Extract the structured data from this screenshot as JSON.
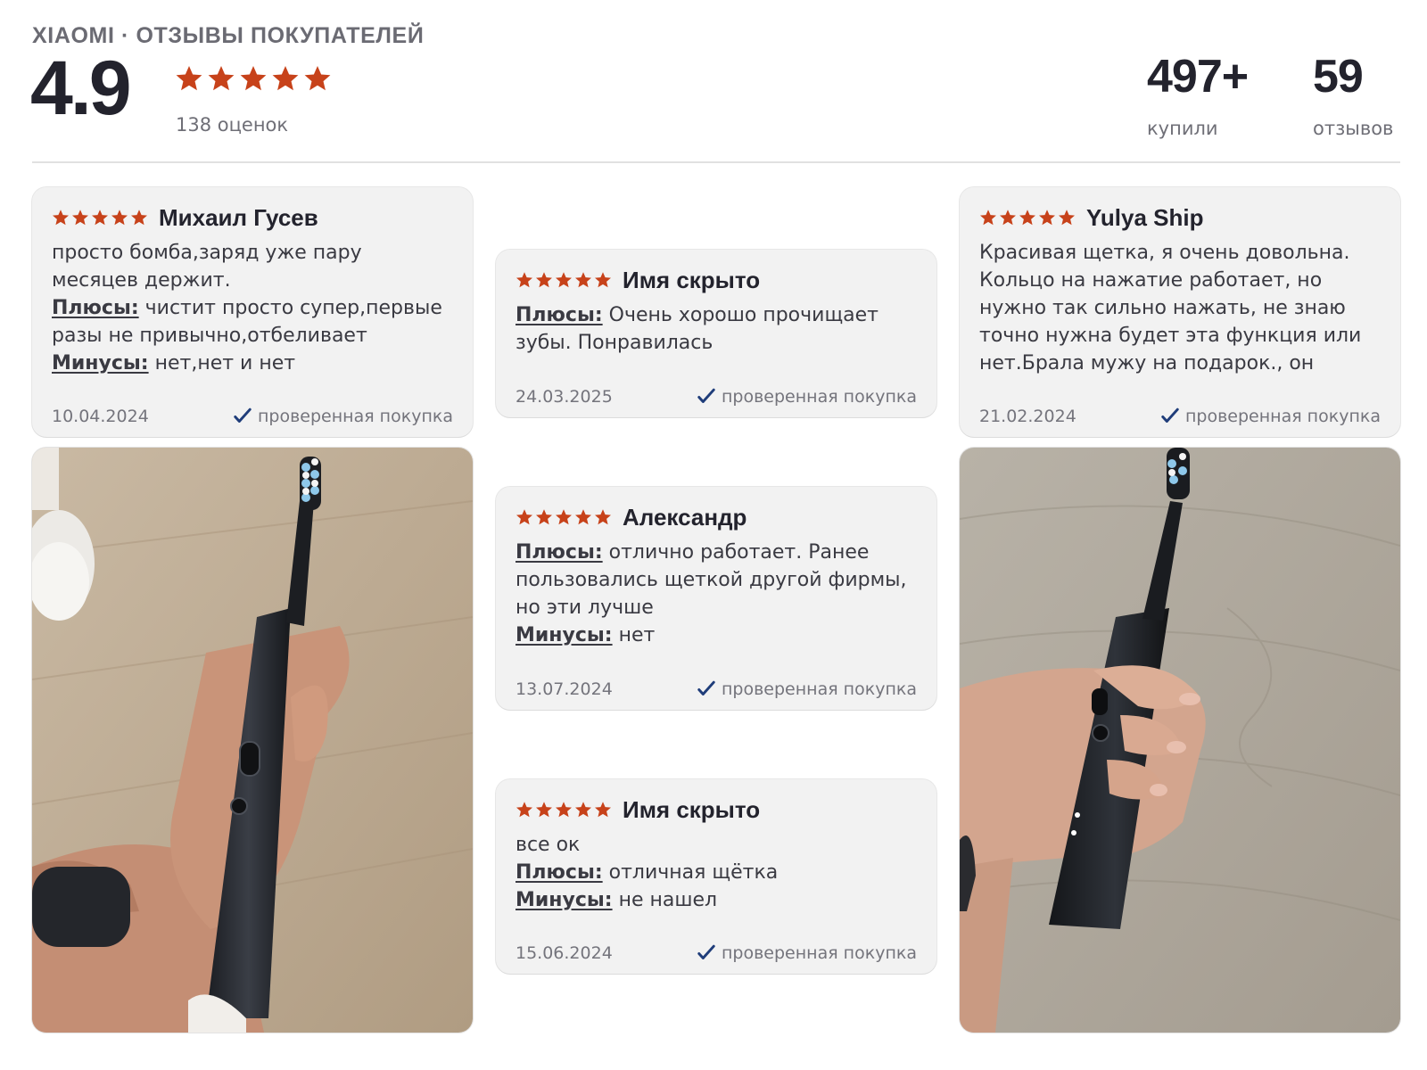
{
  "header": {
    "brand": "XIAOMI · ОТЗЫВЫ ПОКУПАТЕЛЕЙ",
    "rating": "4.9",
    "ratings_count": "138 оценок",
    "stats": [
      {
        "value": "497+",
        "label": "купили"
      },
      {
        "value": "59",
        "label": "отзывов"
      }
    ]
  },
  "colors": {
    "star": "#c7421a",
    "check": "#1f3d7a",
    "card_bg": "#f2f2f2"
  },
  "labels": {
    "pros": "Плюсы:",
    "cons": "Минусы:",
    "verified": "проверенная покупка"
  },
  "reviews": [
    {
      "author": "Михаил Гусев",
      "stars": 5,
      "comment": "просто бомба,заряд уже пару месяцев держит.",
      "pros": "чистит просто супер,первые разы не привычно,отбеливает",
      "cons": "нет,нет и нет",
      "date": "10.04.2024"
    },
    {
      "author": "Имя скрыто",
      "stars": 5,
      "pros": "Очень хорошо прочищает зубы. Понравилась",
      "date": "24.03.2025"
    },
    {
      "author": "Yulya Ship",
      "stars": 5,
      "comment": "Красивая щетка, я очень довольна. Кольцо на нажатие работает, но нужно так сильно нажать, не знаю точно нужна будет эта функция или нет.Брала мужу на подарок., он тоже...",
      "date": "21.02.2024"
    },
    {
      "author": "Александр",
      "stars": 5,
      "pros": "отлично работает. Ранее пользовались щеткой другой фирмы, но эти лучше",
      "cons": "нет",
      "date": "13.07.2024"
    },
    {
      "author": "Имя скрыто",
      "stars": 5,
      "comment": "все ок",
      "pros": "отличная щётка",
      "cons": "не нашел",
      "date": "15.06.2024"
    }
  ],
  "photos": [
    {
      "alt": "toothbrush-in-hand-photo",
      "subject": "black-electric-toothbrush"
    },
    {
      "alt": "toothbrush-in-hand-photo",
      "subject": "black-electric-toothbrush"
    }
  ]
}
